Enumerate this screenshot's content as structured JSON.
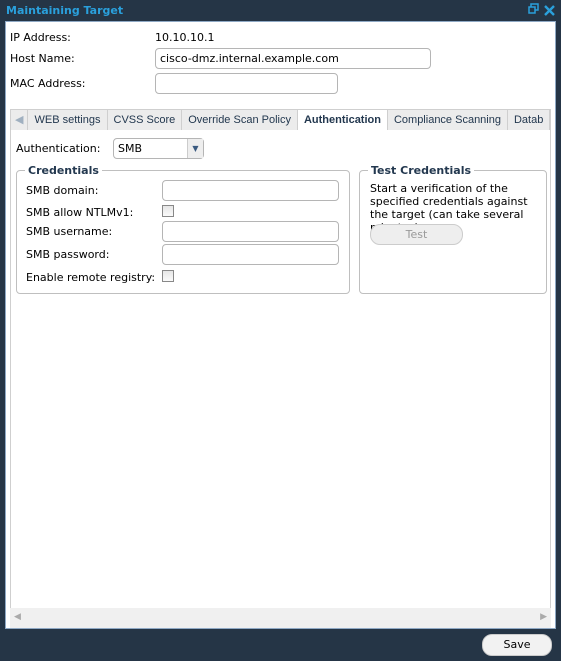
{
  "window": {
    "title": "Maintaining Target",
    "restore_icon": "restore-window-icon",
    "close_icon": "close-icon"
  },
  "form": {
    "ip_label": "IP Address:",
    "ip_value": "10.10.10.1",
    "host_label": "Host Name:",
    "host_value": "cisco-dmz.internal.example.com",
    "mac_label": "MAC Address:",
    "mac_value": ""
  },
  "tabs": [
    {
      "label": "WEB settings"
    },
    {
      "label": "CVSS Score"
    },
    {
      "label": "Override Scan Policy"
    },
    {
      "label": "Authentication",
      "active": true
    },
    {
      "label": "Compliance Scanning"
    },
    {
      "label": "Datab"
    }
  ],
  "auth": {
    "label": "Authentication:",
    "selected": "SMB",
    "credentials": {
      "legend": "Credentials",
      "domain_label": "SMB domain:",
      "domain_value": "",
      "ntlm_label": "SMB allow NTLMv1:",
      "ntlm_checked": false,
      "username_label": "SMB username:",
      "username_value": "",
      "password_label": "SMB password:",
      "password_value": "",
      "registry_label": "Enable remote registry:",
      "registry_checked": false
    },
    "test": {
      "legend": "Test Credentials",
      "description": "Start a verification of the specified credentials against the target (can take several minutes)",
      "button": "Test"
    }
  },
  "footer": {
    "save": "Save"
  },
  "colors": {
    "frame": "#253546",
    "accent": "#2aa0dc"
  }
}
